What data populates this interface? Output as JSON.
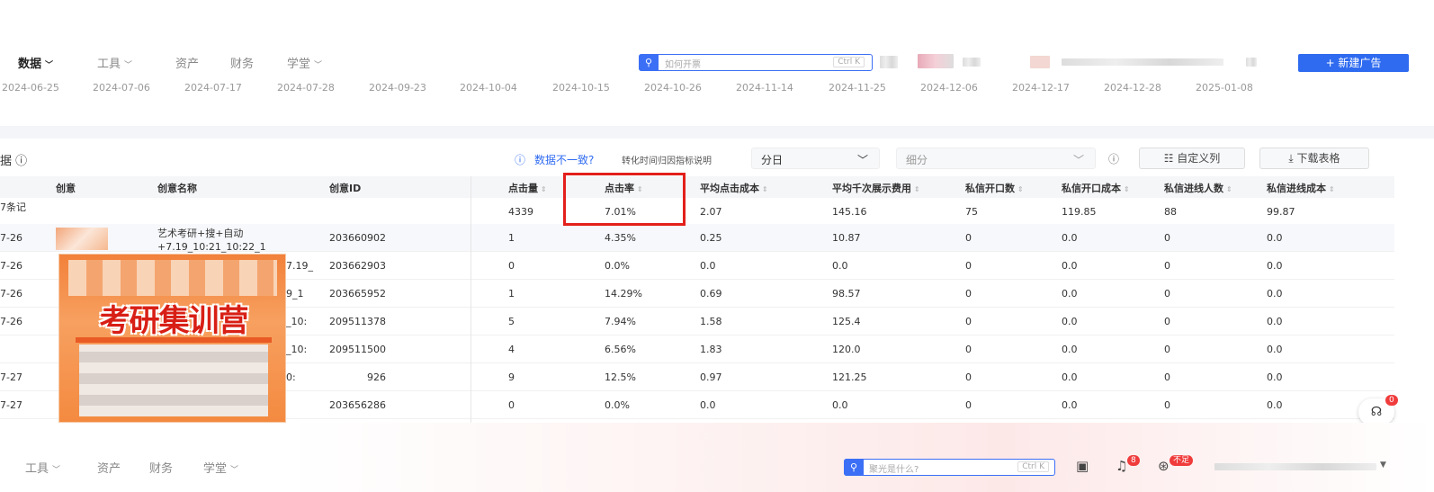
{
  "nav": {
    "items": [
      {
        "label": "数据",
        "chevron": true,
        "active": true
      },
      {
        "label": "工具",
        "chevron": true
      },
      {
        "label": "资产",
        "chevron": false
      },
      {
        "label": "财务",
        "chevron": false
      },
      {
        "label": "学堂",
        "chevron": true
      }
    ],
    "search": {
      "placeholder": "如何开票",
      "shortcut": "Ctrl K"
    },
    "new_ad_button": "+ 新建广告"
  },
  "dates": [
    "2024-06-25",
    "2024-07-06",
    "2024-07-17",
    "2024-07-28",
    "2024-09-23",
    "2024-10-04",
    "2024-10-15",
    "2024-10-26",
    "2024-11-14",
    "2024-11-25",
    "2024-12-06",
    "2024-12-17",
    "2024-12-28",
    "2025-01-08"
  ],
  "toolbar": {
    "section_title": "据 ⓘ",
    "data_mismatch_link": "数据不一致?",
    "attribution_note": "转化时间归因指标说明",
    "granularity_select": "分日",
    "breakdown_select": "细分",
    "custom_columns_button": "自定义列",
    "download_button": "下载表格"
  },
  "table": {
    "columns": [
      "创意",
      "创意名称",
      "创意ID",
      "点击量",
      "点击率",
      "平均点击成本",
      "平均千次展示费用",
      "私信开口数",
      "私信开口成本",
      "私信进线人数",
      "私信进线成本"
    ],
    "summary": {
      "label": "7条记",
      "values": [
        "4339",
        "7.01%",
        "2.07",
        "145.16",
        "75",
        "119.85",
        "88",
        "99.87"
      ]
    },
    "rows": [
      {
        "date": "7-26",
        "name": "艺术考研+搜+自动+7.19_10:21_10:22_1",
        "id": "203660902",
        "values": [
          "1",
          "4.35%",
          "0.25",
          "10.87",
          "0",
          "0.0",
          "0",
          "0.0"
        ]
      },
      {
        "date": "7-26",
        "name": "7.19_",
        "id": "203662903",
        "values": [
          "0",
          "0.0%",
          "0.0",
          "0.0",
          "0",
          "0.0",
          "0",
          "0.0"
        ]
      },
      {
        "date": "7-26",
        "name": "9_1",
        "id": "203665952",
        "values": [
          "1",
          "14.29%",
          "0.69",
          "98.57",
          "0",
          "0.0",
          "0",
          "0.0"
        ]
      },
      {
        "date": "7-26",
        "name": "_10:",
        "id": "209511378",
        "values": [
          "5",
          "7.94%",
          "1.58",
          "125.4",
          "0",
          "0.0",
          "0",
          "0.0"
        ]
      },
      {
        "date": "",
        "name": "_10:",
        "id": "209511500",
        "values": [
          "4",
          "6.56%",
          "1.83",
          "120.0",
          "0",
          "0.0",
          "0",
          "0.0"
        ]
      },
      {
        "date": "7-27",
        "name": "0:",
        "id": "926",
        "values": [
          "9",
          "12.5%",
          "0.97",
          "121.25",
          "0",
          "0.0",
          "0",
          "0.0"
        ]
      },
      {
        "date": "7-27",
        "name": "",
        "id": "203656286",
        "values": [
          "0",
          "0.0%",
          "0.0",
          "0.0",
          "0",
          "0.0",
          "0",
          "0.0"
        ]
      }
    ]
  },
  "poster_text": "考研集训营",
  "bottom_nav": {
    "items": [
      {
        "label": "工具",
        "chevron": true
      },
      {
        "label": "资产",
        "chevron": false
      },
      {
        "label": "财务",
        "chevron": false
      },
      {
        "label": "学堂",
        "chevron": true
      }
    ],
    "search": {
      "placeholder": "聚光是什么?",
      "shortcut": "Ctrl K"
    },
    "notification_count": "8",
    "status_badge": "不足"
  },
  "support_badge": "0",
  "colors": {
    "accent": "#2f6bf0",
    "highlight": "#e3201b"
  }
}
